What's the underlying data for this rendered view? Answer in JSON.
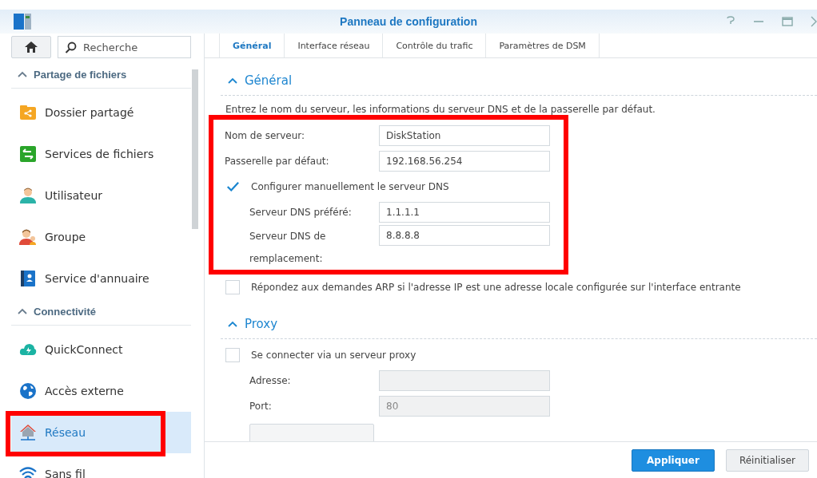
{
  "window": {
    "title": "Panneau de configuration"
  },
  "search": {
    "placeholder": "Recherche"
  },
  "sidebar": {
    "sections": [
      {
        "title": "Partage de fichiers",
        "expanded": true,
        "items": [
          {
            "label": "Dossier partagé",
            "kind": "folder",
            "selected": false
          },
          {
            "label": "Services de fichiers",
            "kind": "transfer",
            "selected": false
          },
          {
            "label": "Utilisateur",
            "kind": "user",
            "selected": false
          },
          {
            "label": "Groupe",
            "kind": "group",
            "selected": false
          },
          {
            "label": "Service d'annuaire",
            "kind": "directory",
            "selected": false
          }
        ]
      },
      {
        "title": "Connectivité",
        "expanded": true,
        "items": [
          {
            "label": "QuickConnect",
            "kind": "cloud",
            "selected": false
          },
          {
            "label": "Accès externe",
            "kind": "globe",
            "selected": false
          },
          {
            "label": "Réseau",
            "kind": "network",
            "selected": true,
            "highlighted": true
          },
          {
            "label": "Sans fil",
            "kind": "wireless",
            "selected": false
          }
        ]
      }
    ]
  },
  "tabs": [
    {
      "label": "Général",
      "selected": true
    },
    {
      "label": "Interface réseau",
      "selected": false
    },
    {
      "label": "Contrôle du trafic",
      "selected": false
    },
    {
      "label": "Paramètres de DSM",
      "selected": false
    }
  ],
  "sections": [
    {
      "title": "Général",
      "expanded": true,
      "description": "Entrez le nom du serveur, les informations du serveur DNS et de la passerelle par défaut.",
      "groups": [
        {
          "highlighted": true,
          "rows": [
            {
              "kind": "field",
              "label": "Nom de serveur:",
              "value": "DiskStation",
              "disabled": false
            },
            {
              "kind": "field",
              "label": "Passerelle par défaut:",
              "value": "192.168.56.254",
              "disabled": false
            },
            {
              "kind": "checkbox",
              "label": "Configurer manuellement le serveur DNS",
              "checked": true
            },
            {
              "kind": "subfield",
              "label": "Serveur DNS préféré:",
              "value": "1.1.1.1",
              "disabled": false
            },
            {
              "kind": "subfield",
              "label": "Serveur DNS de remplacement:",
              "value": "8.8.8.8",
              "disabled": false
            }
          ]
        },
        {
          "rows": [
            {
              "kind": "checkbox",
              "label": "Répondez aux demandes ARP si l'adresse IP est une adresse locale configurée sur l'interface entrante",
              "checked": false
            }
          ]
        }
      ]
    },
    {
      "title": "Proxy",
      "expanded": true,
      "groups": [
        {
          "rows": [
            {
              "kind": "checkbox",
              "label": "Se connecter via un serveur proxy",
              "checked": false
            },
            {
              "kind": "subfield",
              "label": "Adresse:",
              "disabled": true
            },
            {
              "kind": "subfield",
              "label": "Port:",
              "value": "80",
              "disabled": true
            },
            {
              "kind": "button",
              "disabled": true
            }
          ]
        }
      ]
    }
  ],
  "buttons": [
    {
      "label": "Appliquer",
      "kind": "primary"
    },
    {
      "label": "Réinitialiser",
      "kind": "default"
    }
  ]
}
